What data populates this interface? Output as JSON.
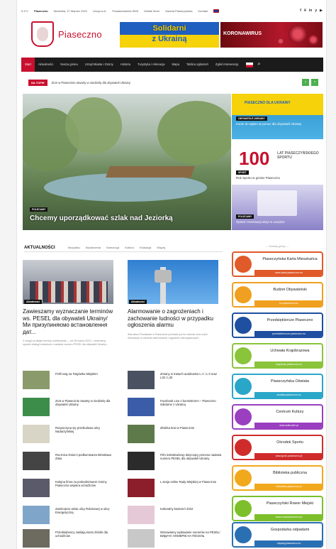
{
  "topbar": {
    "temp": "5.4°C",
    "city": "Piaseczno",
    "date": "Niedziela, 27 Marzec 2022",
    "links": [
      "Urząd w.A.",
      "Powiadomienia SMS",
      "Mobile Mom",
      "Gazeta Piaseczyńska",
      "Kontakt"
    ],
    "social": [
      "f",
      "⌾",
      "in",
      "y",
      "▶"
    ]
  },
  "header": {
    "brand": "Piaseczno",
    "banner1_line1": "Solidarni",
    "banner1_line2": "z Ukrainą",
    "banner2": "KORONAWIRUS"
  },
  "nav": {
    "items": [
      "Start",
      "Aktualności",
      "Nasza gmina",
      "Urząd Miasta i Gminy",
      "Historia",
      "Turystyka i rekreacja",
      "Mapa",
      "Tablica ogłoszeń",
      "Zgłoś interwencję"
    ],
    "active_index": 0
  },
  "ticker": {
    "tag": "NA TOPIE",
    "text": "ZUS w Piasecznie otwarty w niedzielę dla obywateli Ukrainy"
  },
  "hero": {
    "badge": "POLECAMY",
    "title": "Chcemy uporządkować szlak nad Jeziorką"
  },
  "tiles": {
    "t1_header": "PIASECZNO DLA UKRAINY",
    "t1_badge": "OBYWATELE UKRAINY",
    "t1_caption": "Konto do wpłat na pomoc dla obywateli Ukrainy",
    "t2_big": "100",
    "t2_sub": "LAT PIASECZYŃSKIEGO SPORTU",
    "t2_badge": "SPORT",
    "t2_caption": "Rok Sportu w gminie Piaseczno",
    "t3_badge": "POLECAMY",
    "t3_caption": "System rezerwacji wizyt w urzędzie"
  },
  "news": {
    "heading": "AKTUALNOŚCI",
    "tabs": [
      "Wszystko",
      "Wydarzenia",
      "Samorząd",
      "Kultura",
      "Edukacja",
      "Więcej"
    ],
    "big": [
      {
        "badge": "Aktualności",
        "title": "Zawieszamy wyznaczanie terminów ws. PESEL dla obywateli Ukrainy/Ми призупиняємо встановлення дат...",
        "excerpt": "Z uwagi na długie terminy oczekiwania — od 28 marca 2022 r. zmieniamy sposób obsługi wniosków o nadanie numeru PESEL dla obywateli Ukrainy..."
      },
      {
        "badge": "Aktualności",
        "title": "Alarmowanie o zagrożeniach i zachowanie ludności w przypadku ogłoszenia alarmu",
        "excerpt": "Starostwo Powiatowe w Piasecznie przesłało już do sołectw oraz szkół informacje w zakresie alarmowania i sygnałów ostrzegawczych..."
      }
    ],
    "left_list": [
      "Pchli targ na Targówku Miejskim",
      "ZUS w Piasecznie otwarty w niedzielę dla obywateli Ukrainy",
      "Rozpoczyna się przebudowa ulicy Nadarzyńskiej",
      "Rocznica śmierci podkomisarza Mirosława Żaka",
      "Kolejna firma za pośrednictwem Gminy Piaseczno wspiera uchodźców",
      "Zamknięcie wlotu ulicy Rubinowej w ulicę Energetyczną",
      "Przedsiębiorcy zasilają konto zbiórki dla uchodźców"
    ],
    "right_list": [
      "Zmiany w trasach autobusów L-1 i L-3 oraz L32 i L33",
      "Facebook Live z burmistrzem – Piaseczno solidarne z Ukrainą",
      "Zbiórka krwi w Piasecznie",
      "Film instruktażowy dotyczący procesu nadania numeru PESEL dla obywateli Ukrainy",
      "L sesja online Rady Miejskiej w Piasecznie",
      "Kulturalny kwiecień 2022",
      "Wznawiamy wydawanie numerów na PESEL/ВИДАЧА НОМЕРІВ НА ПЕСЕЛЬ"
    ]
  },
  "sidebar": {
    "heading": "— Serwisy gminy —",
    "boxes": [
      {
        "label": "Piaseczyńska Karta Mieszkańca",
        "url": "www.karta.piaseczno.eu",
        "color": "#e05a2a"
      },
      {
        "label": "Budżet Obywatelski",
        "url": "bo.piaseczno.eu",
        "color": "#f0a020"
      },
      {
        "label": "Przedsiębiorcze Piaseczno",
        "url": "przedsiebiorcze.piaseczno.eu",
        "color": "#1f4fa0"
      },
      {
        "label": "Uchwała Krajobrazowa",
        "url": "krajobraz.piaseczno.eu",
        "color": "#8ac43a"
      },
      {
        "label": "Piaseczyńska Oświata",
        "url": "oswiata.piaseczno.eu",
        "color": "#2aa6c9"
      },
      {
        "label": "Centrum Kultury",
        "url": "www.kulturalni.pl",
        "color": "#9a3fc0"
      },
      {
        "label": "Ośrodek Sportu",
        "url": "www.gosir-piaseczno.pl",
        "color": "#d02b2b"
      },
      {
        "label": "Biblioteka publiczna",
        "url": "biblioteka.piaseczno.pl",
        "color": "#f2a81c"
      },
      {
        "label": "Piaseczyński Rower Miejski",
        "url": "www.rowerpiaseczno.pl",
        "color": "#7cbf2a"
      },
      {
        "label": "Gospodarka odpadami",
        "url": "odpady.piaseczno.eu",
        "color": "#2b6fb3"
      }
    ]
  },
  "colors": {
    "accent": "#c8102e",
    "nav_bg": "#1b1b1b",
    "ticker_arrow": "#4caf50"
  }
}
